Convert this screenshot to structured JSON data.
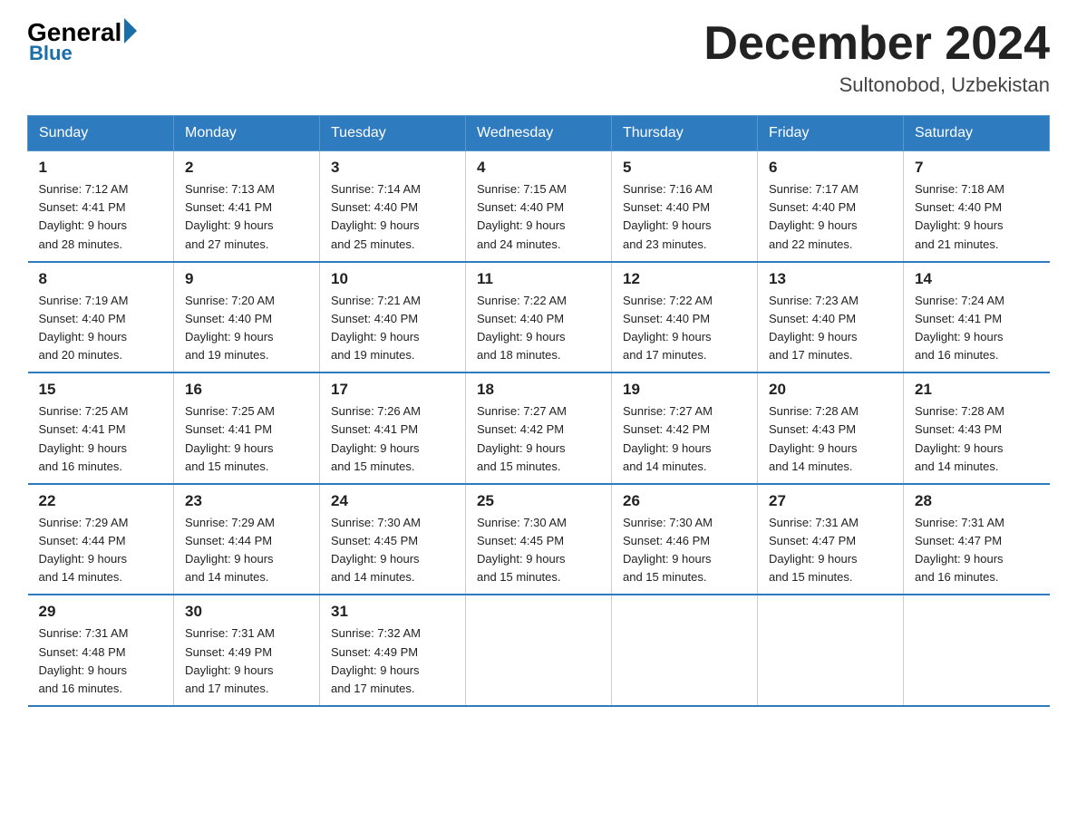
{
  "logo": {
    "general": "General",
    "blue": "Blue"
  },
  "header": {
    "title": "December 2024",
    "location": "Sultonobod, Uzbekistan"
  },
  "days_of_week": [
    "Sunday",
    "Monday",
    "Tuesday",
    "Wednesday",
    "Thursday",
    "Friday",
    "Saturday"
  ],
  "weeks": [
    [
      {
        "day": "1",
        "sunrise": "7:12 AM",
        "sunset": "4:41 PM",
        "daylight": "9 hours and 28 minutes."
      },
      {
        "day": "2",
        "sunrise": "7:13 AM",
        "sunset": "4:41 PM",
        "daylight": "9 hours and 27 minutes."
      },
      {
        "day": "3",
        "sunrise": "7:14 AM",
        "sunset": "4:40 PM",
        "daylight": "9 hours and 25 minutes."
      },
      {
        "day": "4",
        "sunrise": "7:15 AM",
        "sunset": "4:40 PM",
        "daylight": "9 hours and 24 minutes."
      },
      {
        "day": "5",
        "sunrise": "7:16 AM",
        "sunset": "4:40 PM",
        "daylight": "9 hours and 23 minutes."
      },
      {
        "day": "6",
        "sunrise": "7:17 AM",
        "sunset": "4:40 PM",
        "daylight": "9 hours and 22 minutes."
      },
      {
        "day": "7",
        "sunrise": "7:18 AM",
        "sunset": "4:40 PM",
        "daylight": "9 hours and 21 minutes."
      }
    ],
    [
      {
        "day": "8",
        "sunrise": "7:19 AM",
        "sunset": "4:40 PM",
        "daylight": "9 hours and 20 minutes."
      },
      {
        "day": "9",
        "sunrise": "7:20 AM",
        "sunset": "4:40 PM",
        "daylight": "9 hours and 19 minutes."
      },
      {
        "day": "10",
        "sunrise": "7:21 AM",
        "sunset": "4:40 PM",
        "daylight": "9 hours and 19 minutes."
      },
      {
        "day": "11",
        "sunrise": "7:22 AM",
        "sunset": "4:40 PM",
        "daylight": "9 hours and 18 minutes."
      },
      {
        "day": "12",
        "sunrise": "7:22 AM",
        "sunset": "4:40 PM",
        "daylight": "9 hours and 17 minutes."
      },
      {
        "day": "13",
        "sunrise": "7:23 AM",
        "sunset": "4:40 PM",
        "daylight": "9 hours and 17 minutes."
      },
      {
        "day": "14",
        "sunrise": "7:24 AM",
        "sunset": "4:41 PM",
        "daylight": "9 hours and 16 minutes."
      }
    ],
    [
      {
        "day": "15",
        "sunrise": "7:25 AM",
        "sunset": "4:41 PM",
        "daylight": "9 hours and 16 minutes."
      },
      {
        "day": "16",
        "sunrise": "7:25 AM",
        "sunset": "4:41 PM",
        "daylight": "9 hours and 15 minutes."
      },
      {
        "day": "17",
        "sunrise": "7:26 AM",
        "sunset": "4:41 PM",
        "daylight": "9 hours and 15 minutes."
      },
      {
        "day": "18",
        "sunrise": "7:27 AM",
        "sunset": "4:42 PM",
        "daylight": "9 hours and 15 minutes."
      },
      {
        "day": "19",
        "sunrise": "7:27 AM",
        "sunset": "4:42 PM",
        "daylight": "9 hours and 14 minutes."
      },
      {
        "day": "20",
        "sunrise": "7:28 AM",
        "sunset": "4:43 PM",
        "daylight": "9 hours and 14 minutes."
      },
      {
        "day": "21",
        "sunrise": "7:28 AM",
        "sunset": "4:43 PM",
        "daylight": "9 hours and 14 minutes."
      }
    ],
    [
      {
        "day": "22",
        "sunrise": "7:29 AM",
        "sunset": "4:44 PM",
        "daylight": "9 hours and 14 minutes."
      },
      {
        "day": "23",
        "sunrise": "7:29 AM",
        "sunset": "4:44 PM",
        "daylight": "9 hours and 14 minutes."
      },
      {
        "day": "24",
        "sunrise": "7:30 AM",
        "sunset": "4:45 PM",
        "daylight": "9 hours and 14 minutes."
      },
      {
        "day": "25",
        "sunrise": "7:30 AM",
        "sunset": "4:45 PM",
        "daylight": "9 hours and 15 minutes."
      },
      {
        "day": "26",
        "sunrise": "7:30 AM",
        "sunset": "4:46 PM",
        "daylight": "9 hours and 15 minutes."
      },
      {
        "day": "27",
        "sunrise": "7:31 AM",
        "sunset": "4:47 PM",
        "daylight": "9 hours and 15 minutes."
      },
      {
        "day": "28",
        "sunrise": "7:31 AM",
        "sunset": "4:47 PM",
        "daylight": "9 hours and 16 minutes."
      }
    ],
    [
      {
        "day": "29",
        "sunrise": "7:31 AM",
        "sunset": "4:48 PM",
        "daylight": "9 hours and 16 minutes."
      },
      {
        "day": "30",
        "sunrise": "7:31 AM",
        "sunset": "4:49 PM",
        "daylight": "9 hours and 17 minutes."
      },
      {
        "day": "31",
        "sunrise": "7:32 AM",
        "sunset": "4:49 PM",
        "daylight": "9 hours and 17 minutes."
      },
      null,
      null,
      null,
      null
    ]
  ],
  "labels": {
    "sunrise": "Sunrise:",
    "sunset": "Sunset:",
    "daylight": "Daylight:"
  }
}
